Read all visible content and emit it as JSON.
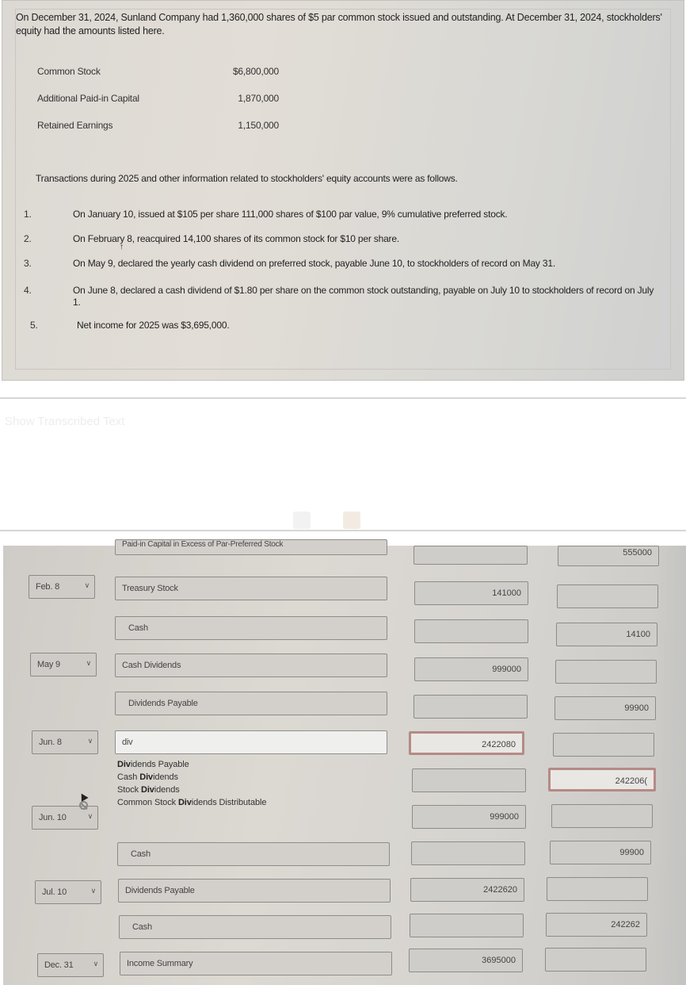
{
  "problem": {
    "intro": "On December 31, 2024, Sunland Company had 1,360,000 shares of $5 par common stock issued and outstanding. At December 31, 2024, stockholders' equity had the amounts listed here.",
    "equity": [
      {
        "label": "Common Stock",
        "amount": "$6,800,000"
      },
      {
        "label": "Additional Paid-in Capital",
        "amount": "1,870,000"
      },
      {
        "label": "Retained Earnings",
        "amount": "1,150,000"
      }
    ],
    "transactions_heading": "Transactions during 2025 and other information related to stockholders' equity accounts were as follows.",
    "transactions": [
      {
        "num": "1.",
        "text": "On January 10, issued at $105 per share 111,000 shares of $100 par value, 9% cumulative preferred stock."
      },
      {
        "num": "2.",
        "text": "On February 8, reacquired 14,100 shares of its common stock for $10 per share."
      },
      {
        "num": "3.",
        "text": "On May 9, declared the yearly cash dividend on preferred stock, payable June 10, to stockholders of record on May 31."
      },
      {
        "num": "4.",
        "text": "On June 8, declared a cash dividend of $1.80 per share on the common stock outstanding, payable on July 10 to stockholders of record on July 1."
      },
      {
        "num": "5.",
        "text": "Net income for 2025 was $3,695,000."
      }
    ]
  },
  "show_transcribed_text": "Show Transcribed Text",
  "journal": {
    "partial_row": {
      "account": "Paid-in Capital in Excess of Par-Preferred Stock",
      "credit": "555000"
    },
    "rows": [
      {
        "date": "Feb. 8",
        "account": "Treasury Stock",
        "debit": "141000",
        "credit": ""
      },
      {
        "date": "",
        "account": "Cash",
        "debit": "",
        "credit": "14100"
      },
      {
        "date": "May 9",
        "account": "Cash Dividends",
        "debit": "999000",
        "credit": ""
      },
      {
        "date": "",
        "account": "Dividends Payable",
        "debit": "",
        "credit": "99900"
      },
      {
        "date": "Jun. 8",
        "account": "div",
        "debit": "2422080",
        "credit": ""
      },
      {
        "date": "",
        "account": "",
        "debit": "",
        "credit": "242206("
      },
      {
        "date": "Jun. 10",
        "account": "",
        "debit": "999000",
        "credit": ""
      },
      {
        "date": "",
        "account": "Cash",
        "debit": "",
        "credit": "99900"
      },
      {
        "date": "Jul. 10",
        "account": "Dividends Payable",
        "debit": "2422620",
        "credit": ""
      },
      {
        "date": "",
        "account": "Cash",
        "debit": "",
        "credit": "242262"
      },
      {
        "date": "Dec. 31",
        "account": "Income Summary",
        "debit": "3695000",
        "credit": ""
      }
    ],
    "autocomplete": {
      "query": "div",
      "options": [
        {
          "bold": "Div",
          "rest": "idends Payable",
          "prefix": ""
        },
        {
          "prefix": "Cash ",
          "bold": "Div",
          "rest": "idends"
        },
        {
          "prefix": "Stock ",
          "bold": "Div",
          "rest": "idends"
        },
        {
          "prefix": "Common Stock ",
          "bold": "Div",
          "rest": "idends Distributable"
        }
      ]
    }
  },
  "colors": {
    "error_border": "#b58a86"
  }
}
